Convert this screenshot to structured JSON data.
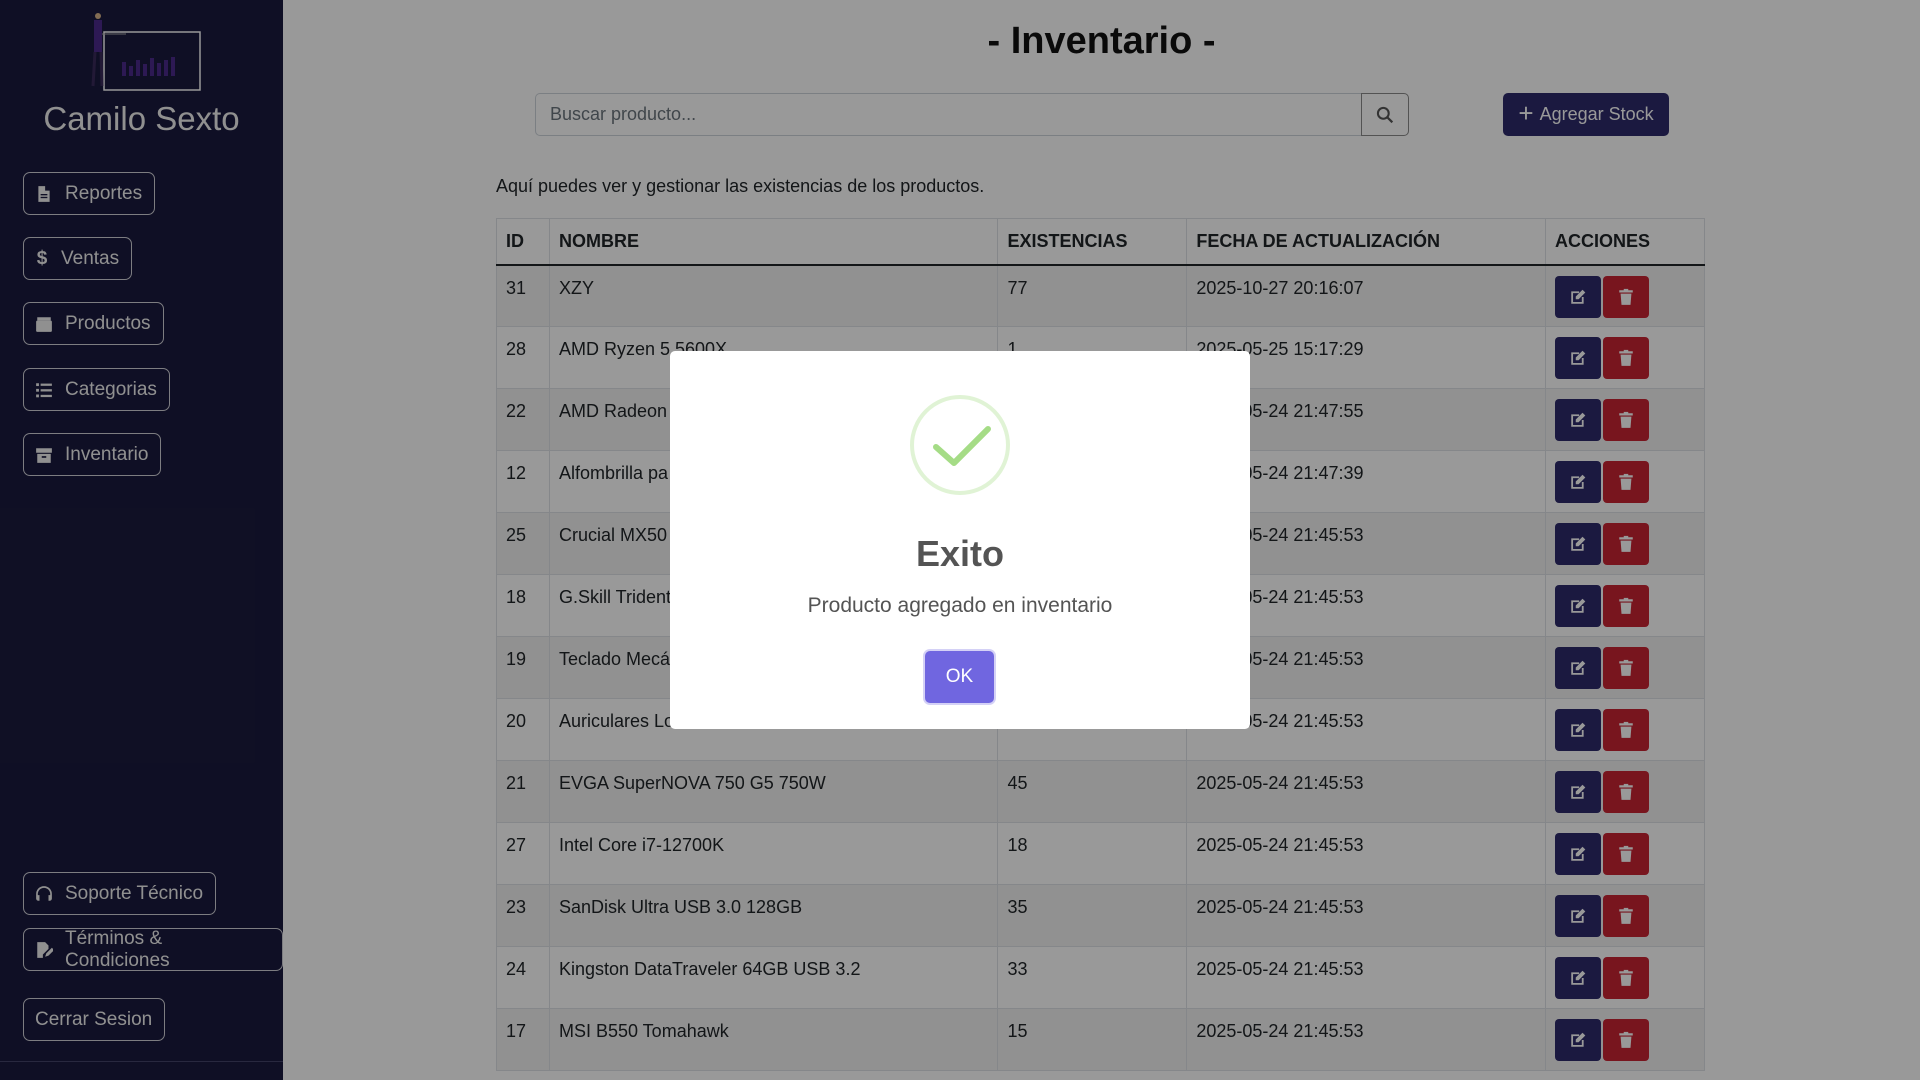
{
  "sidebar": {
    "brand": "Camilo Sexto",
    "nav": [
      {
        "label": "Reportes",
        "icon": "file-icon"
      },
      {
        "label": "Ventas",
        "icon": "dollar-icon"
      },
      {
        "label": "Productos",
        "icon": "box-icon"
      },
      {
        "label": "Categorias",
        "icon": "list-icon"
      },
      {
        "label": "Inventario",
        "icon": "archive-icon"
      }
    ],
    "support": "Soporte Técnico",
    "terms": "Términos & Condiciones",
    "logout": "Cerrar Sesion"
  },
  "main": {
    "title": "- Inventario -",
    "search_placeholder": "Buscar producto...",
    "add_stock_label": "Agregar Stock",
    "subtitle": "Aquí puedes ver y gestionar las existencias de los productos.",
    "columns": [
      "ID",
      "NOMBRE",
      "EXISTENCIAS",
      "FECHA DE ACTUALIZACIÓN",
      "ACCIONES"
    ],
    "rows": [
      {
        "id": "31",
        "name": "XZY",
        "stock": "77",
        "date": "2025-10-27 20:16:07"
      },
      {
        "id": "28",
        "name": "AMD Ryzen 5 5600X",
        "stock": "1",
        "date": "2025-05-25 15:17:29"
      },
      {
        "id": "22",
        "name": "AMD Radeon",
        "stock": "",
        "date": "2025-05-24 21:47:55"
      },
      {
        "id": "12",
        "name": "Alfombrilla pa",
        "stock": "",
        "date": "2025-05-24 21:47:39"
      },
      {
        "id": "25",
        "name": "Crucial MX50",
        "stock": "",
        "date": "2025-05-24 21:45:53"
      },
      {
        "id": "18",
        "name": "G.Skill Trident",
        "stock": "",
        "date": "2025-05-24 21:45:53"
      },
      {
        "id": "19",
        "name": "Teclado Mecá",
        "stock": "",
        "date": "2025-05-24 21:45:53"
      },
      {
        "id": "20",
        "name": "Auriculares Lo",
        "stock": "",
        "date": "2025-05-24 21:45:53"
      },
      {
        "id": "21",
        "name": "EVGA SuperNOVA 750 G5 750W",
        "stock": "45",
        "date": "2025-05-24 21:45:53"
      },
      {
        "id": "27",
        "name": "Intel Core i7-12700K",
        "stock": "18",
        "date": "2025-05-24 21:45:53"
      },
      {
        "id": "23",
        "name": "SanDisk Ultra USB 3.0 128GB",
        "stock": "35",
        "date": "2025-05-24 21:45:53"
      },
      {
        "id": "24",
        "name": "Kingston DataTraveler 64GB USB 3.2",
        "stock": "33",
        "date": "2025-05-24 21:45:53"
      },
      {
        "id": "17",
        "name": "MSI B550 Tomahawk",
        "stock": "15",
        "date": "2025-05-24 21:45:53"
      }
    ]
  },
  "modal": {
    "title": "Exito",
    "message": "Producto agregado en inventario",
    "ok_label": "OK"
  },
  "colors": {
    "sidebar_bg": "#1a1a3e",
    "primary": "#2e2a6b",
    "danger": "#c82333",
    "ok_button": "#7066e0",
    "success_check": "#a5dc86"
  }
}
